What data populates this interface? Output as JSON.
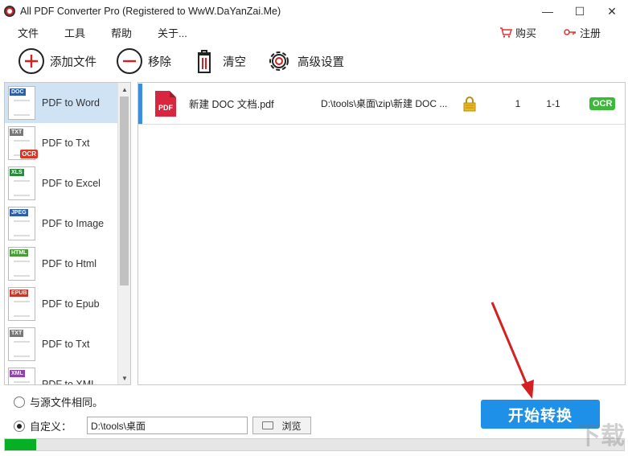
{
  "window": {
    "title": "All PDF Converter Pro (Registered to WwW.DaYanZai.Me)",
    "minimize": "—",
    "maximize": "☐",
    "close": "✕"
  },
  "menu": {
    "items": [
      "文件",
      "工具",
      "帮助",
      "关于..."
    ],
    "buy": "购买",
    "register": "注册"
  },
  "toolbar": {
    "add_file": "添加文件",
    "remove": "移除",
    "clear": "清空",
    "advanced": "高级设置"
  },
  "sidebar": {
    "items": [
      {
        "label": "PDF to Word",
        "tag": "DOC",
        "tag_color": "#2f5ea8",
        "selected": true
      },
      {
        "label": "PDF to Txt",
        "tag": "TXT",
        "tag_color": "#777777",
        "ocr": "OCR"
      },
      {
        "label": "PDF to Excel",
        "tag": "XLS",
        "tag_color": "#2b8a3e"
      },
      {
        "label": "PDF to Image",
        "tag": "JPEG",
        "tag_color": "#2f5ea8"
      },
      {
        "label": "PDF to Html",
        "tag": "HTML",
        "tag_color": "#4a9a3a"
      },
      {
        "label": "PDF to Epub",
        "tag": "EPUB",
        "tag_color": "#c0392b"
      },
      {
        "label": "PDF to Txt",
        "tag": "TXT",
        "tag_color": "#777777"
      },
      {
        "label": "PDF to XML",
        "tag": "XML",
        "tag_color": "#8e44ad"
      }
    ]
  },
  "files": [
    {
      "icon_text": "PDF",
      "name": "新建 DOC 文档.pdf",
      "path": "D:\\tools\\桌面\\zip\\新建 DOC ...",
      "pages": "1",
      "range": "1-1",
      "ocr": "OCR"
    }
  ],
  "output": {
    "same_as_source": "与源文件相同。",
    "custom": "自定义：",
    "custom_path": "D:\\tools\\桌面",
    "browse": "浏览",
    "selected": "custom"
  },
  "start_button": "开始转换",
  "progress": {
    "fraction": 0.05,
    "color": "#06b025"
  },
  "colors": {
    "accent": "#1e90e8",
    "selection": "#cfe3f5",
    "arrow": "#d42020"
  },
  "watermark": "下载"
}
